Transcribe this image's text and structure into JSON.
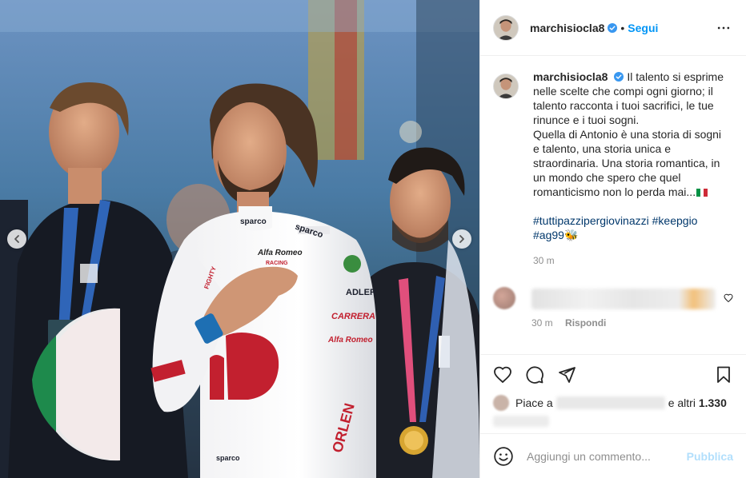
{
  "post": {
    "username": "marchisiocla8",
    "follow_label": "Segui",
    "dot": "•",
    "more_icon": "more-horizontal-icon"
  },
  "photo": {
    "suit_texts": {
      "sparco_collar": "sparco",
      "sparco_chest": "sparco",
      "alfa_romeo": "Alfa Romeo",
      "racing": "RACING",
      "adler": "ADLER",
      "carrera": "CARRERA",
      "alfa_romeo_2": "Alfa Romeo",
      "orlen": "ORLEN",
      "fighty": "FIGHTY",
      "sparco_belt": "sparco"
    },
    "prev_icon": "chevron-left-icon",
    "next_icon": "chevron-right-icon"
  },
  "caption": {
    "username": "marchisiocla8",
    "text_lines": [
      "Il talento si esprime nelle scelte che compi ogni giorno; il talento racconta i tuoi sacrifici, le tue rinunce e i tuoi sogni.",
      "Quella di Antonio è una storia di sogni e talento, una storia unica e straordinaria. Una storia romantica, in un mondo che spero che quel romanticismo non lo perda mai..."
    ],
    "hashtags": "#tuttipazzipergiovinazzi #keepgio #ag99",
    "emoji": "🐝",
    "time": "30 m",
    "flag_colors": [
      "#009246",
      "#ffffff",
      "#ce2b37"
    ]
  },
  "comment": {
    "time": "30 m",
    "reply_label": "Rispondi",
    "like_icon": "heart-outline-icon"
  },
  "actions": {
    "like_icon": "heart-icon",
    "comment_icon": "comment-icon",
    "share_icon": "send-icon",
    "save_icon": "bookmark-icon",
    "likes_prefix": "Piace a",
    "likes_suffix": "e altri",
    "likes_count": "1.330"
  },
  "add_comment": {
    "placeholder": "Aggiungi un commento...",
    "publish_label": "Pubblica",
    "emoji_icon": "smiley-icon"
  },
  "colors": {
    "accent": "#0095f6",
    "publish_disabled": "#b2dffc",
    "hashtag": "#00376b",
    "muted": "#8e8e8e"
  }
}
